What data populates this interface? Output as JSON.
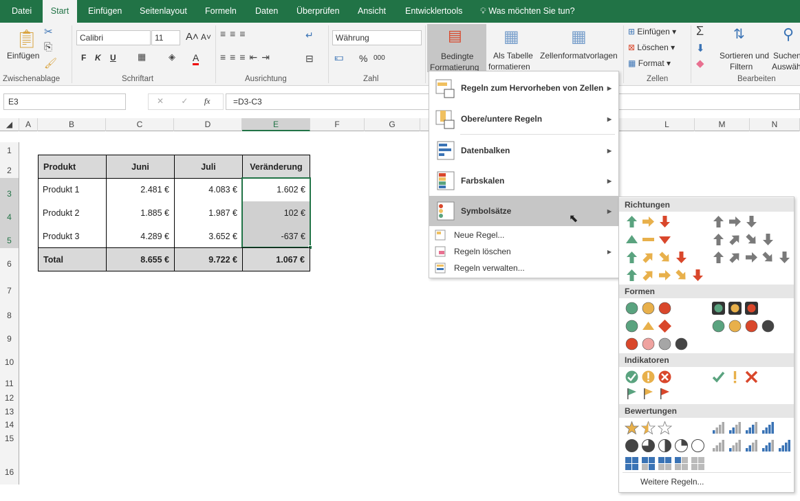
{
  "tabs": [
    "Datei",
    "Start",
    "Einfügen",
    "Seitenlayout",
    "Formeln",
    "Daten",
    "Überprüfen",
    "Ansicht",
    "Entwicklertools"
  ],
  "tell_me": "Was möchten Sie tun?",
  "ribbon": {
    "paste": "Einfügen",
    "clipboard": "Zwischenablage",
    "font_name": "Calibri",
    "font_size": "11",
    "bold": "F",
    "italic": "K",
    "underline": "U",
    "font_group": "Schriftart",
    "align_group": "Ausrichtung",
    "number_format": "Währung",
    "percent": "%",
    "thousands": "000",
    "number_group": "Zahl",
    "cond_fmt_1": "Bedingte",
    "cond_fmt_2": "Formatierung",
    "table_1": "Als Tabelle",
    "table_2": "formatieren",
    "styles": "Zellenformatvorlagen",
    "insert": "Einfügen",
    "delete": "Löschen",
    "format": "Format",
    "cells_group": "Zellen",
    "sort_1": "Sortieren und",
    "sort_2": "Filtern",
    "find_1": "Suchen",
    "find_2": "Auswäh",
    "edit_group": "Bearbeiten"
  },
  "formula_bar": {
    "name_box": "E3",
    "fx": "fx",
    "formula": "=D3-C3"
  },
  "columns": [
    "A",
    "B",
    "C",
    "D",
    "E",
    "F",
    "G",
    "L",
    "M",
    "N"
  ],
  "rows": [
    "1",
    "2",
    "3",
    "4",
    "5",
    "6",
    "7",
    "8",
    "9",
    "10",
    "11",
    "12",
    "13",
    "14",
    "15",
    "16"
  ],
  "table": {
    "headers": [
      "Produkt",
      "Juni",
      "Juli",
      "Veränderung"
    ],
    "rows": [
      [
        "Produkt 1",
        "2.481 €",
        "4.083 €",
        "1.602 €"
      ],
      [
        "Produkt 2",
        "1.885 €",
        "1.987 €",
        "102 €"
      ],
      [
        "Produkt 3",
        "4.289 €",
        "3.652 €",
        "-637 €"
      ]
    ],
    "total": [
      "Total",
      "8.655 €",
      "9.722 €",
      "1.067 €"
    ]
  },
  "menu": {
    "items": [
      "Regeln zum Hervorheben von Zellen",
      "Obere/untere Regeln",
      "Datenbalken",
      "Farbskalen",
      "Symbolsätze"
    ],
    "small": [
      "Neue Regel...",
      "Regeln löschen",
      "Regeln verwalten..."
    ]
  },
  "submenu": {
    "sections": [
      "Richtungen",
      "Formen",
      "Indikatoren",
      "Bewertungen"
    ],
    "more": "Weitere Regeln...",
    "colors": {
      "green": "#5aa37f",
      "yellow": "#e8b04b",
      "red": "#d9472b",
      "gray": "#7a7a7a",
      "dark": "#444444",
      "pink": "#efa3a0",
      "lgray": "#a6a6a6",
      "blue": "#3a73b5"
    },
    "sets": [
      [
        "up:green",
        "right:yellow",
        "down:red"
      ],
      [
        "up:gray",
        "right:gray",
        "down:gray"
      ],
      [
        "tri:green",
        "bar:yellow",
        "tridown:red"
      ],
      [
        "up:gray",
        "ne:gray",
        "se:gray",
        "down:gray"
      ],
      [
        "up:green",
        "ne:yellow",
        "se:yellow",
        "down:red"
      ],
      [
        "up:gray",
        "ne:gray",
        "right:gray",
        "se:gray",
        "down:gray"
      ],
      [
        "up:green",
        "ne:yellow",
        "right:yellow",
        "se:yellow",
        "down:red"
      ],
      [
        "circle:green",
        "circle:yellow",
        "circle:red"
      ],
      [
        "light:green",
        "light:yellow",
        "light:red"
      ],
      [
        "circle:green",
        "tri:yellow",
        "diamond:red"
      ],
      [
        "circle:green",
        "circle:yellow",
        "circle:red",
        "circle:dark"
      ],
      [
        "circle:red",
        "circle:pink",
        "circle:lgray",
        "circle:dark"
      ],
      [
        "check:green",
        "excl:yellow",
        "cross:red"
      ],
      [
        "plaincheck:green",
        "plainexcl:yellow",
        "plaincross:red"
      ],
      [
        "flag:green",
        "flag:yellow",
        "flag:red"
      ],
      [
        "star:1",
        "star:0.5",
        "star:0"
      ],
      [
        "signal:1",
        "signal:2",
        "signal:3",
        "signal:4"
      ],
      [
        "pie:1",
        "pie:0.75",
        "pie:0.5",
        "pie:0.25",
        "pie:0"
      ],
      [
        "signal:0",
        "signal:1",
        "signal:2",
        "signal:3",
        "signal:4"
      ],
      [
        "quad:4",
        "quad:3",
        "quad:2",
        "quad:1",
        "quad:0"
      ]
    ]
  }
}
